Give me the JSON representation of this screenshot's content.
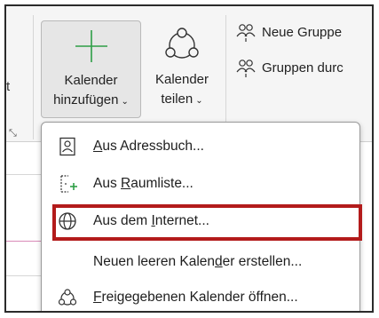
{
  "ribbon": {
    "prev_group_fragment": "t",
    "group_launcher_symbol": "⤡",
    "add_calendar": {
      "line1": "Kalender",
      "line2": "hinzufügen",
      "chevron": "⌄",
      "icon": "plus-icon"
    },
    "share_calendar": {
      "line1": "Kalender",
      "line2": "teilen",
      "chevron": "⌄",
      "icon": "share-icon"
    },
    "new_group": {
      "label": "Neue Gruppe",
      "icon": "people-group-icon"
    },
    "browse_groups": {
      "label": "Gruppen durc",
      "icon": "people-group-icon"
    }
  },
  "menu": {
    "items": [
      {
        "prefix": "",
        "accel": "A",
        "rest": "us Adressbuch...",
        "icon": "address-book-icon"
      },
      {
        "prefix": "Aus ",
        "accel": "R",
        "rest": "aumliste...",
        "icon": "room-list-icon"
      },
      {
        "prefix": "Aus dem ",
        "accel": "I",
        "rest": "nternet...",
        "icon": "globe-icon"
      },
      {
        "prefix": "Neuen leeren Kalen",
        "accel": "d",
        "rest": "er erstellen...",
        "icon": ""
      },
      {
        "prefix": "",
        "accel": "F",
        "rest": "reigegebenen Kalender öffnen...",
        "icon": "shared-calendar-icon"
      }
    ]
  },
  "colors": {
    "accent_green": "#2e9e46",
    "highlight_red": "#b31b1b",
    "calendar_pink": "#d98ab8"
  }
}
